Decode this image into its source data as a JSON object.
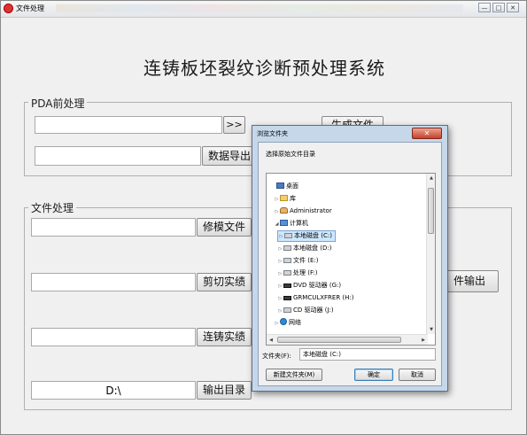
{
  "window": {
    "title": "文件处理",
    "minimize_glyph": "—",
    "maximize_glyph": "□",
    "close_glyph": "✕"
  },
  "main": {
    "heading": "连铸板坯裂纹诊断预处理系统"
  },
  "pda_group": {
    "label": "PDA前处理",
    "path_value": "",
    "browse_label": ">>",
    "generate_label": "生成文件",
    "export_value": "",
    "export_label": "数据导出"
  },
  "file_group": {
    "label": "文件处理",
    "rows": [
      {
        "value": "",
        "button": "修模文件"
      },
      {
        "value": "",
        "button": "剪切实绩"
      },
      {
        "value": "",
        "button": "连铸实绩"
      },
      {
        "value": "D:\\",
        "button": "输出目录"
      }
    ],
    "output_button_partial": "件输出"
  },
  "dialog": {
    "title": "浏览文件夹",
    "close_glyph": "✕",
    "prompt": "选择原始文件目录",
    "tree": [
      {
        "label": "桌面",
        "icon": "desktop-icon",
        "level": 0,
        "toggle": ""
      },
      {
        "label": "库",
        "icon": "folder-icon",
        "level": 1,
        "toggle": "▷"
      },
      {
        "label": "Administrator",
        "icon": "user-folder-icon",
        "level": 1,
        "toggle": "▷"
      },
      {
        "label": "计算机",
        "icon": "computer-icon",
        "level": 1,
        "toggle": "◢"
      },
      {
        "label": "本地磁盘 (C:)",
        "icon": "drive-icon",
        "level": 2,
        "toggle": "▷",
        "selected": true
      },
      {
        "label": "本地磁盘 (D:)",
        "icon": "drive-icon",
        "level": 2,
        "toggle": "▷"
      },
      {
        "label": "文件 (E:)",
        "icon": "drive-icon",
        "level": 2,
        "toggle": "▷"
      },
      {
        "label": "处理 (F:)",
        "icon": "drive-icon",
        "level": 2,
        "toggle": "▷"
      },
      {
        "label": "DVD 驱动器 (G:)",
        "icon": "dvd-drive-icon",
        "level": 2,
        "toggle": "▷"
      },
      {
        "label": "GRMCULXFRER (H:)",
        "icon": "dvd-drive-icon",
        "level": 2,
        "toggle": "▷"
      },
      {
        "label": "CD 驱动器 (J:)",
        "icon": "drive-icon",
        "level": 2,
        "toggle": "▷"
      },
      {
        "label": "网络",
        "icon": "network-icon",
        "level": 1,
        "toggle": "▷"
      }
    ],
    "folder_label": "文件夹(F):",
    "folder_value": "本地磁盘 (C:)",
    "new_folder_label": "新建文件夹(M)",
    "ok_label": "确定",
    "cancel_label": "取消"
  }
}
